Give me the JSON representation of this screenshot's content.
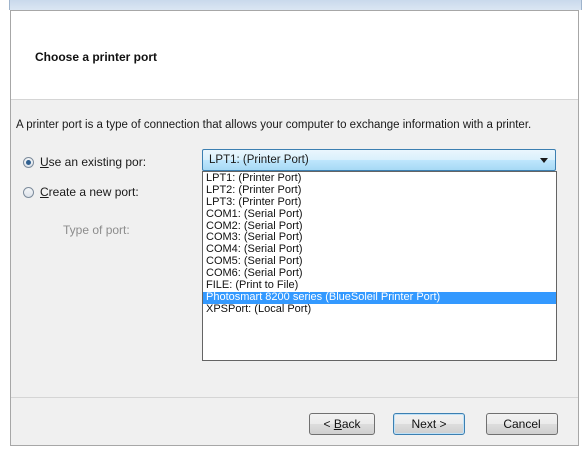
{
  "header": {
    "title": "Choose a printer port"
  },
  "description": "A printer port is a type of connection that allows your computer to exchange information with a printer.",
  "options": {
    "existing": {
      "label_mnemonic": "U",
      "label_rest": "se an existing por:",
      "checked": true
    },
    "create": {
      "label_mnemonic": "C",
      "label_rest": "reate a new port:",
      "checked": false
    },
    "type_of_port_label": "Type of port:"
  },
  "port_combo": {
    "value": "LPT1: (Printer Port)",
    "items": [
      "LPT1: (Printer Port)",
      "LPT2: (Printer Port)",
      "LPT3: (Printer Port)",
      "COM1: (Serial Port)",
      "COM2: (Serial Port)",
      "COM3: (Serial Port)",
      "COM4: (Serial Port)",
      "COM5: (Serial Port)",
      "COM6: (Serial Port)",
      "FILE: (Print to File)",
      "Photosmart 8200 series (BlueSoleil Printer Port)",
      "XPSPort: (Local Port)"
    ],
    "highlighted_index": 10
  },
  "buttons": {
    "back_prefix": "< ",
    "back_mnemonic": "B",
    "back_rest": "ack",
    "next": "Next >",
    "cancel": "Cancel"
  },
  "colors": {
    "highlight": "#3399ff",
    "accent": "#3c7fb1"
  }
}
